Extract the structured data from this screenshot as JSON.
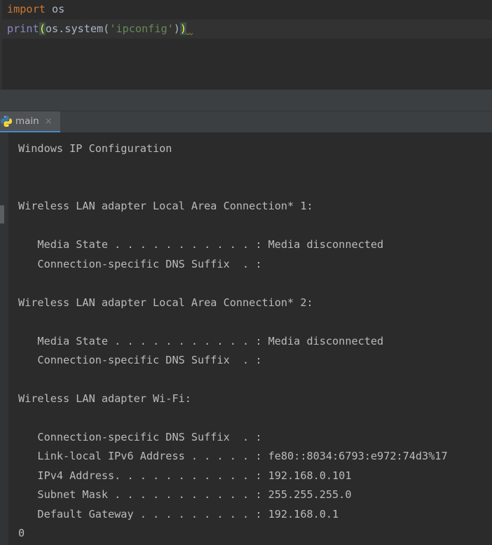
{
  "editor": {
    "line1": {
      "keyword": "import",
      "module": " os"
    },
    "line2": {
      "func": "print",
      "open_paren": "(",
      "call": "os.system(",
      "arg": "'ipconfig'",
      "inner_close": ")",
      "outer_close": ")"
    }
  },
  "run_tab": {
    "label": "main",
    "close": "×"
  },
  "console": {
    "lines": [
      "Windows IP Configuration",
      "",
      "",
      "Wireless LAN adapter Local Area Connection* 1:",
      "",
      "   Media State . . . . . . . . . . . : Media disconnected",
      "   Connection-specific DNS Suffix  . :",
      "",
      "Wireless LAN adapter Local Area Connection* 2:",
      "",
      "   Media State . . . . . . . . . . . : Media disconnected",
      "   Connection-specific DNS Suffix  . :",
      "",
      "Wireless LAN adapter Wi-Fi:",
      "",
      "   Connection-specific DNS Suffix  . :",
      "   Link-local IPv6 Address . . . . . : fe80::8034:6793:e972:74d3%17",
      "   IPv4 Address. . . . . . . . . . . : 192.168.0.101",
      "   Subnet Mask . . . . . . . . . . . : 255.255.255.0",
      "   Default Gateway . . . . . . . . . : 192.168.0.1",
      "0"
    ]
  },
  "colors": {
    "keyword": "#cc7832",
    "builtin": "#8888c6",
    "string": "#6a8759",
    "text": "#a9b7c6",
    "console_text": "#bbbbbb",
    "tab_underline": "#4a88c7"
  },
  "icons": {
    "tab_icon": "python-icon"
  }
}
